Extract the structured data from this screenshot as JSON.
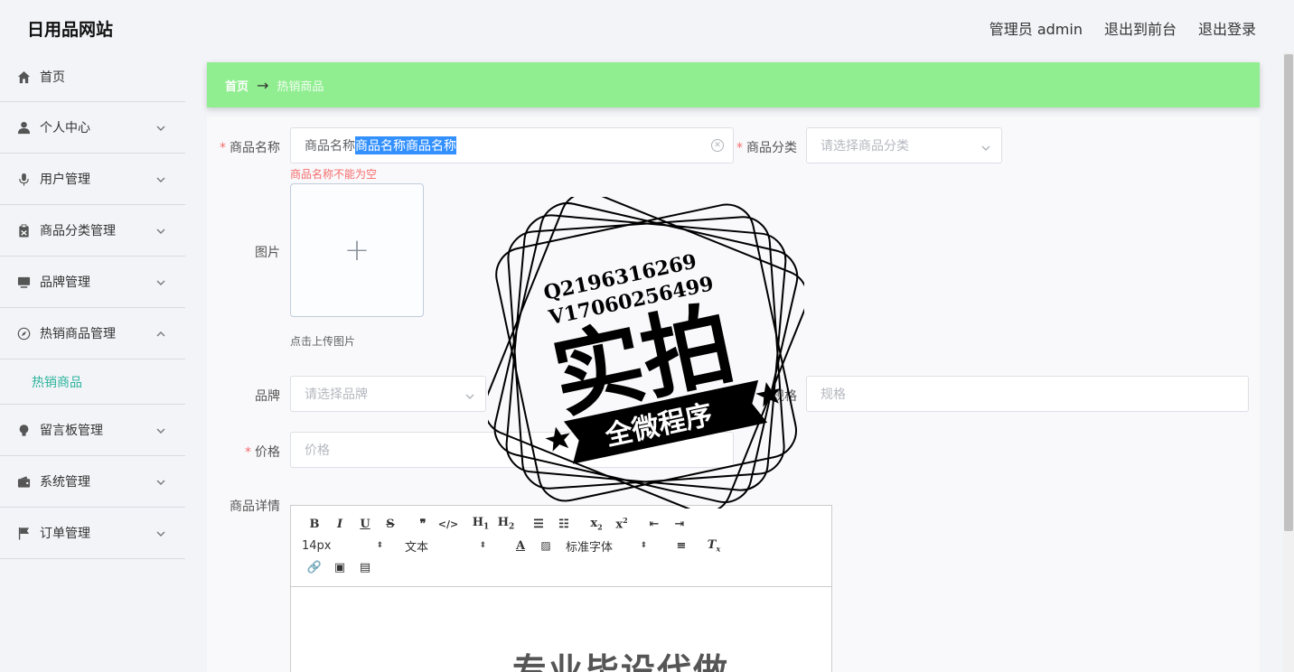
{
  "header": {
    "site_title": "日用品网站",
    "admin_label": "管理员 admin",
    "to_frontend": "退出到前台",
    "logout": "退出登录"
  },
  "sidebar": {
    "items": [
      {
        "label": "首页",
        "icon": "home-icon"
      },
      {
        "label": "个人中心",
        "icon": "user-icon"
      },
      {
        "label": "用户管理",
        "icon": "microphone-icon"
      },
      {
        "label": "商品分类管理",
        "icon": "clipboard-icon"
      },
      {
        "label": "品牌管理",
        "icon": "monitor-icon"
      },
      {
        "label": "热销商品管理",
        "icon": "compass-icon"
      },
      {
        "label": "留言板管理",
        "icon": "bulb-icon"
      },
      {
        "label": "系统管理",
        "icon": "wallet-icon"
      },
      {
        "label": "订单管理",
        "icon": "flag-icon"
      }
    ],
    "active_sub": "热销商品"
  },
  "breadcrumb": {
    "home": "首页",
    "arrow": "→",
    "current": "热销商品"
  },
  "form": {
    "name_label": "商品名称",
    "name_value_plain": "商品名称",
    "name_value_selected": "商品名称商品名称",
    "name_error": "商品名称不能为空",
    "category_label": "商品分类",
    "category_placeholder": "请选择商品分类",
    "image_label": "图片",
    "upload_tip": "点击上传图片",
    "brand_label": "品牌",
    "brand_placeholder": "请选择品牌",
    "spec_label": "规格",
    "spec_placeholder": "规格",
    "price_label": "价格",
    "price_placeholder": "价格",
    "detail_label": "商品详情"
  },
  "editor": {
    "font_size": "14px",
    "paragraph": "文本",
    "font_family": "标准字体",
    "body_text": "专业毕设代做"
  },
  "watermark": {
    "line1": "Q2196316269",
    "line2": "V17060256499",
    "big": "实拍",
    "banner": "全微程序"
  }
}
